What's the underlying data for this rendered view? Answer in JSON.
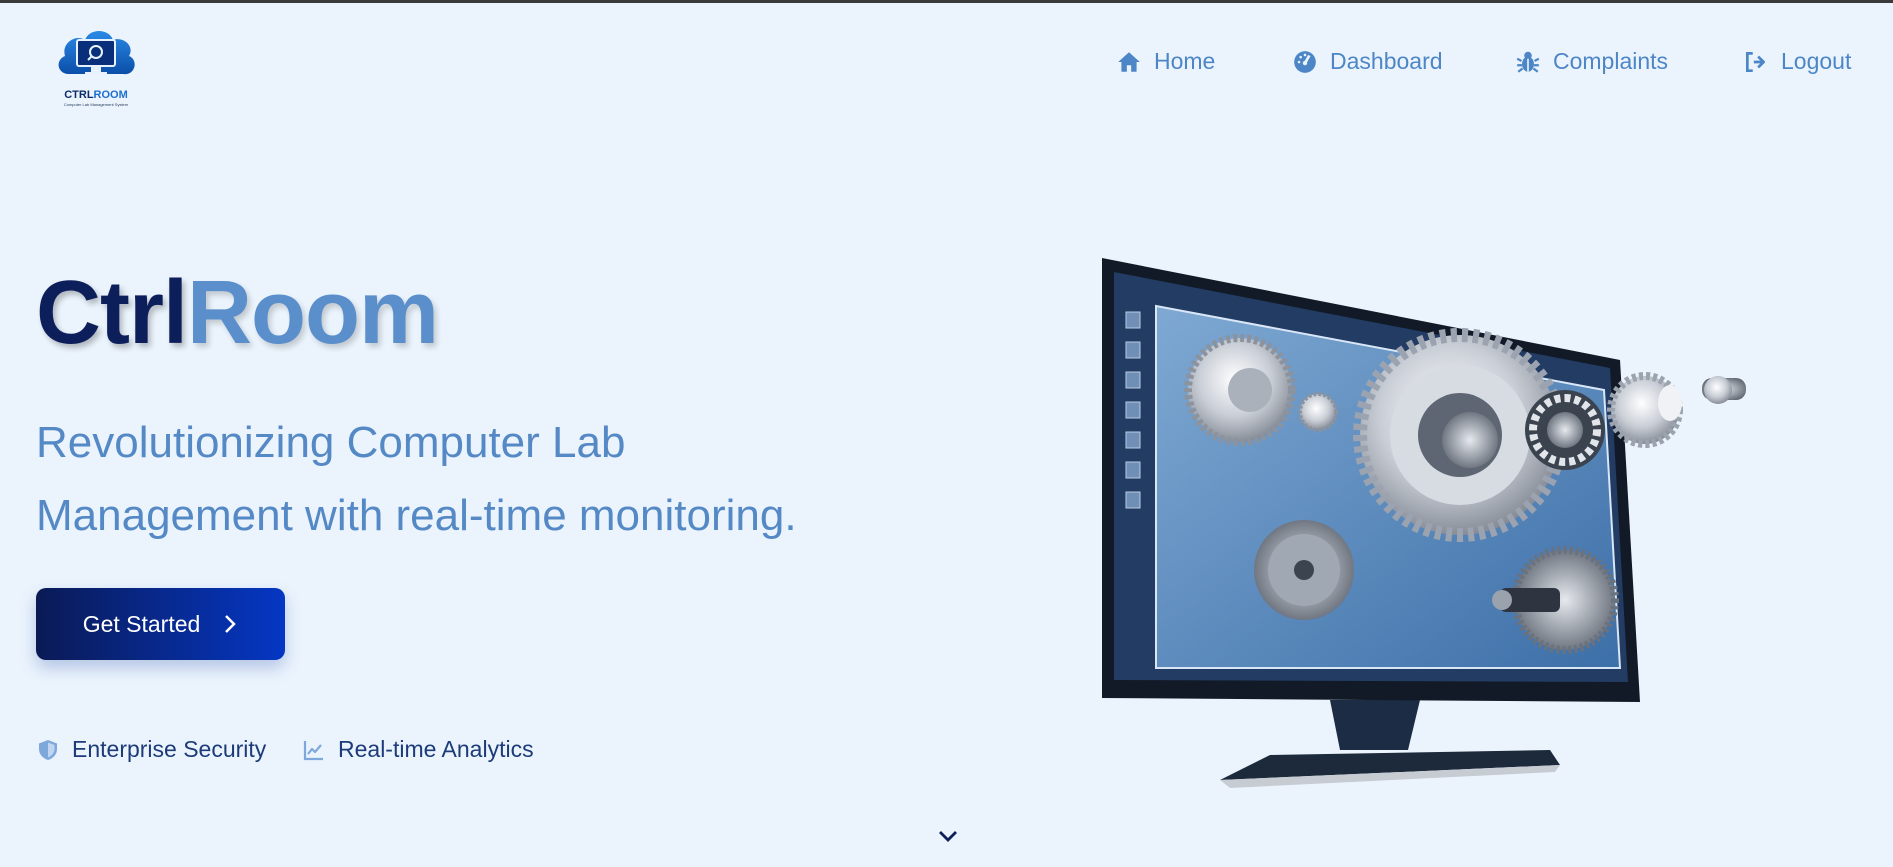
{
  "brand": {
    "logo_text_dark": "CTRL",
    "logo_text_accent": "ROOM",
    "logo_subtitle": "Computer Lab Management System"
  },
  "nav": {
    "items": [
      {
        "label": "Home",
        "icon": "home-icon"
      },
      {
        "label": "Dashboard",
        "icon": "tachometer-icon"
      },
      {
        "label": "Complaints",
        "icon": "bug-icon"
      },
      {
        "label": "Logout",
        "icon": "logout-icon"
      }
    ]
  },
  "hero": {
    "title_part1": "Ctrl",
    "title_part2": "Room",
    "tagline_line1": "Revolutionizing Computer Lab",
    "tagline_line2": "Management with real-time monitoring.",
    "cta_label": "Get Started",
    "features": [
      {
        "label": "Enterprise Security",
        "icon": "shield-icon"
      },
      {
        "label": "Real-time Analytics",
        "icon": "chart-line-icon"
      }
    ]
  },
  "colors": {
    "background": "#ebf4fd",
    "primary_dark": "#0c1f5b",
    "accent_blue": "#5b8fcb",
    "nav_text": "#4d86c6",
    "cta_gradient_start": "#0a1a55",
    "cta_gradient_end": "#0537c4"
  }
}
